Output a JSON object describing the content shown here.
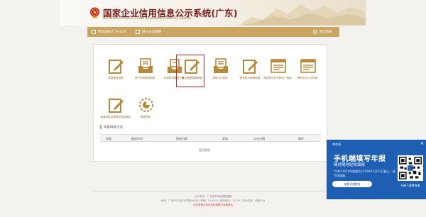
{
  "header": {
    "title": "国家企业信用信息公示系统(广东)",
    "subtitle": "National Enterprise Credit Information Publicity System"
  },
  "topbar": {
    "company": "梁氏国际(广东)公司",
    "center": "进入企业联络",
    "logout": "退出登录"
  },
  "tiles": [
    {
      "label": "年报报告填报",
      "icon": "pen-paper-icon",
      "selected": false
    },
    {
      "label": "资产负债报表填报",
      "icon": "document-box-icon",
      "selected": false
    },
    {
      "label": "年报报告模板下载",
      "icon": "tray-download-icon",
      "selected": false
    },
    {
      "label": "营业数据填报填报",
      "icon": "pen-paper-icon",
      "selected": true
    },
    {
      "label": "其他公示信息",
      "icon": "document-box-icon",
      "selected": false
    },
    {
      "label": "隐名股东填报填报",
      "icon": "pen-paper-icon",
      "selected": false
    },
    {
      "label": "商务部业务系统统一填报",
      "icon": "document-list-icon",
      "selected": false
    },
    {
      "label": "海关企业公示信息",
      "icon": "document-list-icon",
      "selected": false
    },
    {
      "label": "经营地址变更登记信息报告",
      "icon": "pen-paper-icon",
      "selected": false
    },
    {
      "label": "报表预览",
      "icon": "gear-pie-icon",
      "selected": false
    }
  ],
  "records": {
    "title": "年报填报记录",
    "columns": [
      "年度",
      "报送年份",
      "报送日期",
      "状态",
      "公示日期",
      "操作"
    ],
    "empty": "暂无数据"
  },
  "footer": {
    "line1": "主办单位：广东省市场监督管理局",
    "line2": "地址：广州市天河区天河路468号 | 邮编：510620 | 咨询电话：12315 | 技术支持：信用平台",
    "line3": "业务咨询与技术支持请拨打当地电话"
  },
  "promo": {
    "logo": "粤商通",
    "title": "手机端填写年报",
    "subtitle": "随时随地轻松填报",
    "desc": "个体户2019年度报告2020年12月31日截止，请尽快填报。",
    "button": "查看详细教程",
    "qr_caption": "扫码下载粤商通"
  },
  "colors": {
    "gold": "#c9a561",
    "icon_gold": "#b8893a",
    "promo_blue": "#1e5eb3",
    "selected_border": "#cc2222"
  }
}
